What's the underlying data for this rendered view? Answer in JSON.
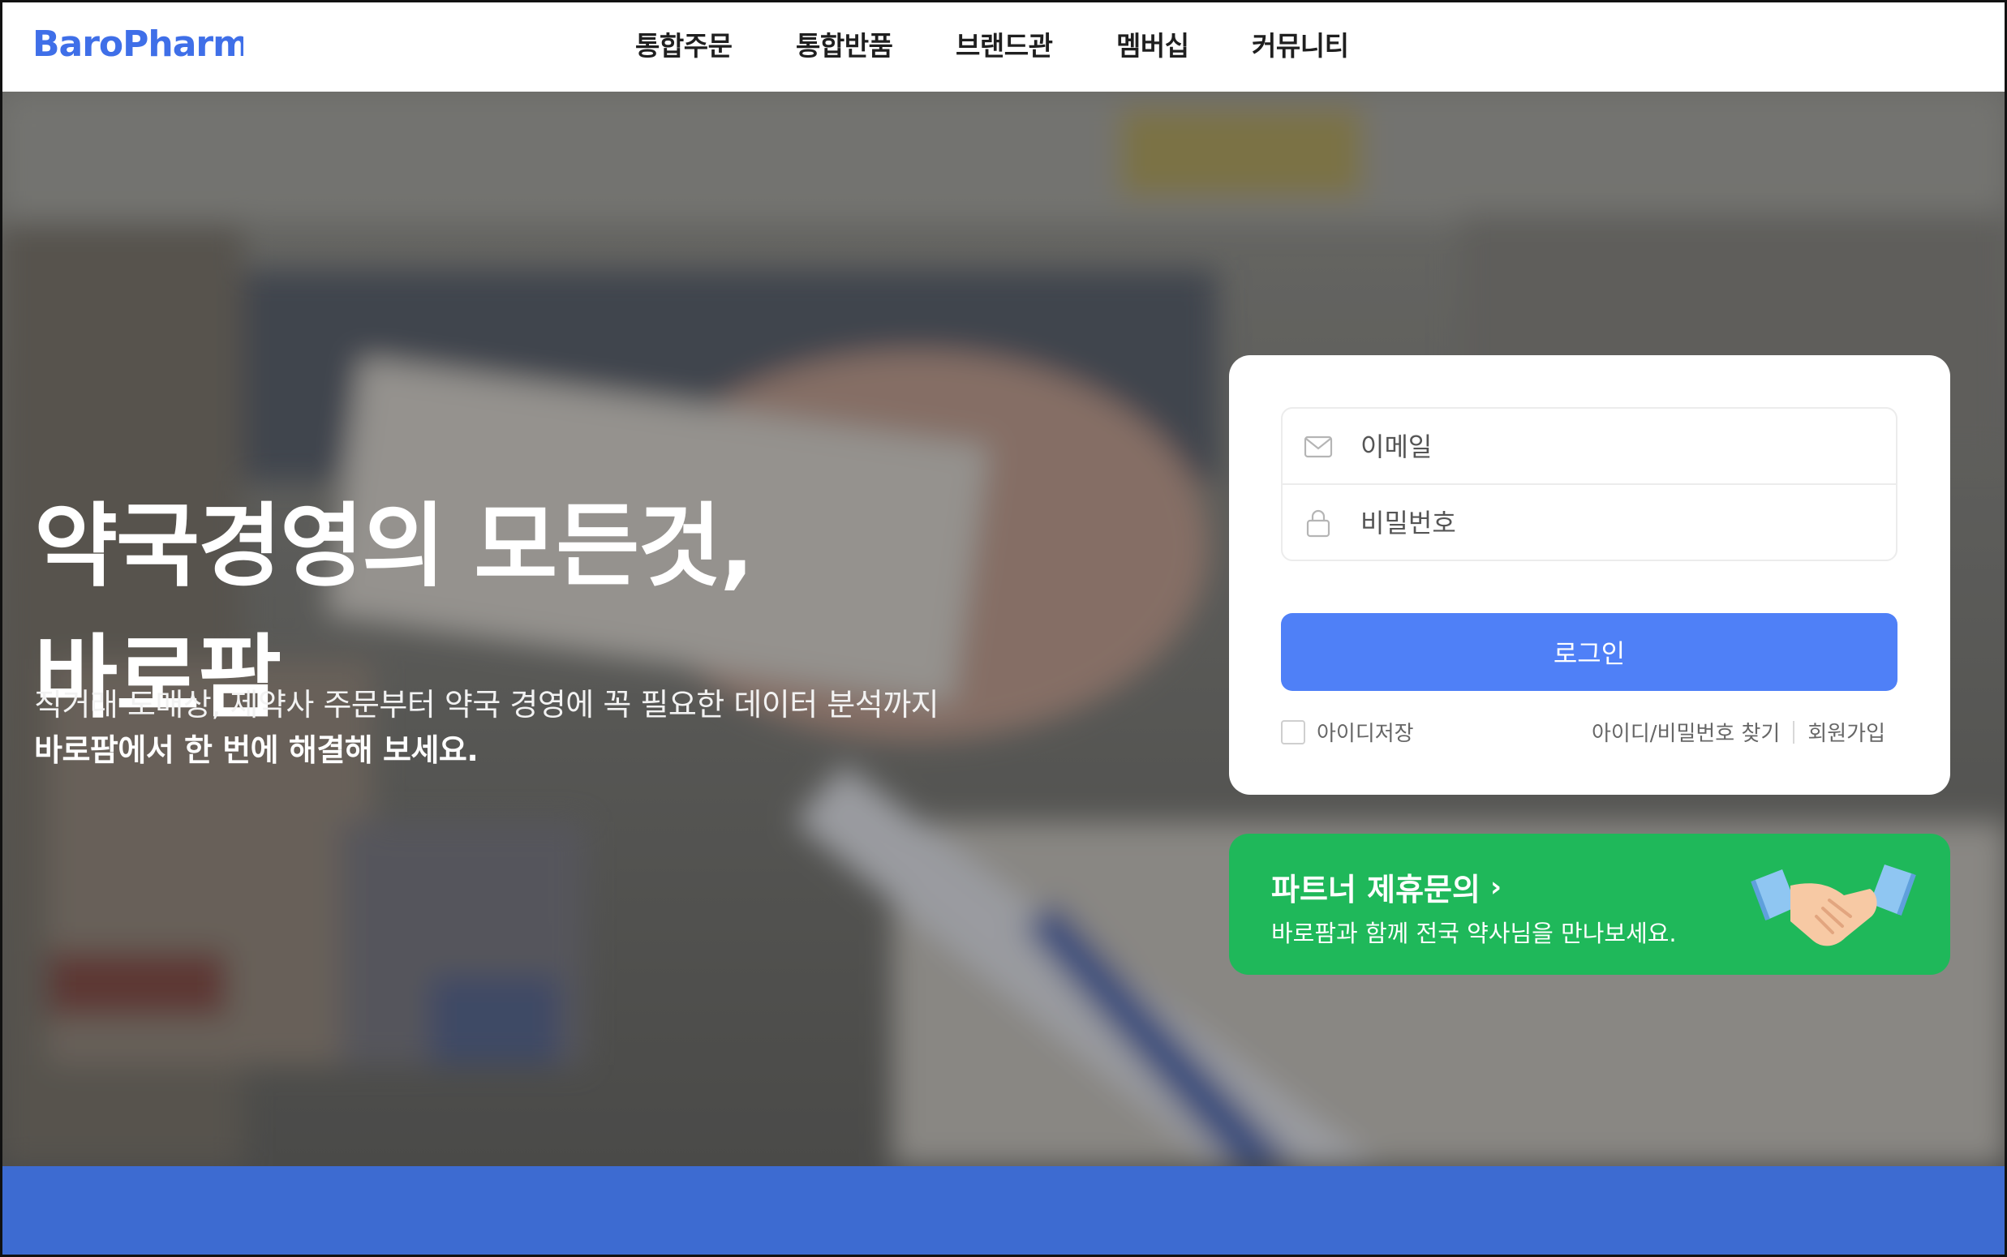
{
  "header": {
    "logo_text": "BaroPharm",
    "nav": [
      {
        "label": "통합주문"
      },
      {
        "label": "통합반품"
      },
      {
        "label": "브랜드관"
      },
      {
        "label": "멤버십"
      },
      {
        "label": "커뮤니티"
      }
    ]
  },
  "hero": {
    "headline_line1": "약국경영의 모든것,",
    "headline_line2": "바로팜",
    "sub_line1": "직거래 도매상, 제약사 주문부터 약국 경영에 꼭 필요한 데이터 분석까지",
    "sub_line2": "바로팜에서 한 번에 해결해 보세요."
  },
  "login": {
    "email_placeholder": "이메일",
    "password_placeholder": "비밀번호",
    "login_button": "로그인",
    "remember_label": "아이디저장",
    "find_link": "아이디/비밀번호 찾기",
    "signup_link": "회원가입",
    "email_icon": "mail-icon",
    "password_icon": "lock-icon"
  },
  "partner": {
    "title": "파트너 제휴문의",
    "chevron": "›",
    "subtitle": "바로팜과 함께 전국 약사님을 만나보세요.",
    "icon": "handshake-icon"
  },
  "colors": {
    "brand_blue": "#4f80f7",
    "logo_blue": "#3f6fe8",
    "partner_green": "#1fb85a",
    "bottom_band": "#3d6bd1"
  }
}
